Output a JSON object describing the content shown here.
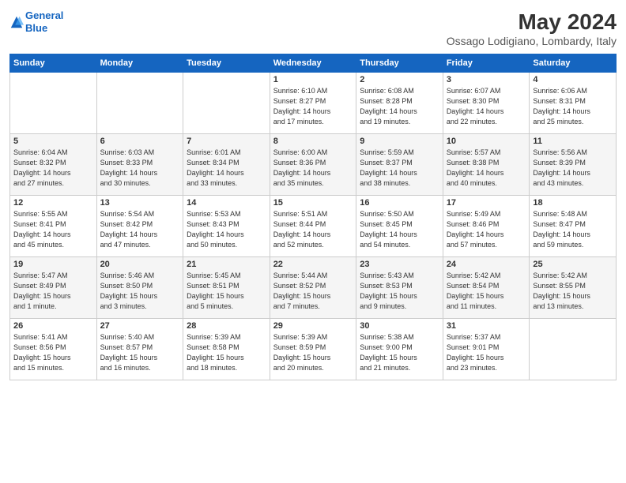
{
  "logo": {
    "line1": "General",
    "line2": "Blue"
  },
  "title": "May 2024",
  "subtitle": "Ossago Lodigiano, Lombardy, Italy",
  "days_header": [
    "Sunday",
    "Monday",
    "Tuesday",
    "Wednesday",
    "Thursday",
    "Friday",
    "Saturday"
  ],
  "weeks": [
    [
      {
        "day": "",
        "info": ""
      },
      {
        "day": "",
        "info": ""
      },
      {
        "day": "",
        "info": ""
      },
      {
        "day": "1",
        "info": "Sunrise: 6:10 AM\nSunset: 8:27 PM\nDaylight: 14 hours\nand 17 minutes."
      },
      {
        "day": "2",
        "info": "Sunrise: 6:08 AM\nSunset: 8:28 PM\nDaylight: 14 hours\nand 19 minutes."
      },
      {
        "day": "3",
        "info": "Sunrise: 6:07 AM\nSunset: 8:30 PM\nDaylight: 14 hours\nand 22 minutes."
      },
      {
        "day": "4",
        "info": "Sunrise: 6:06 AM\nSunset: 8:31 PM\nDaylight: 14 hours\nand 25 minutes."
      }
    ],
    [
      {
        "day": "5",
        "info": "Sunrise: 6:04 AM\nSunset: 8:32 PM\nDaylight: 14 hours\nand 27 minutes."
      },
      {
        "day": "6",
        "info": "Sunrise: 6:03 AM\nSunset: 8:33 PM\nDaylight: 14 hours\nand 30 minutes."
      },
      {
        "day": "7",
        "info": "Sunrise: 6:01 AM\nSunset: 8:34 PM\nDaylight: 14 hours\nand 33 minutes."
      },
      {
        "day": "8",
        "info": "Sunrise: 6:00 AM\nSunset: 8:36 PM\nDaylight: 14 hours\nand 35 minutes."
      },
      {
        "day": "9",
        "info": "Sunrise: 5:59 AM\nSunset: 8:37 PM\nDaylight: 14 hours\nand 38 minutes."
      },
      {
        "day": "10",
        "info": "Sunrise: 5:57 AM\nSunset: 8:38 PM\nDaylight: 14 hours\nand 40 minutes."
      },
      {
        "day": "11",
        "info": "Sunrise: 5:56 AM\nSunset: 8:39 PM\nDaylight: 14 hours\nand 43 minutes."
      }
    ],
    [
      {
        "day": "12",
        "info": "Sunrise: 5:55 AM\nSunset: 8:41 PM\nDaylight: 14 hours\nand 45 minutes."
      },
      {
        "day": "13",
        "info": "Sunrise: 5:54 AM\nSunset: 8:42 PM\nDaylight: 14 hours\nand 47 minutes."
      },
      {
        "day": "14",
        "info": "Sunrise: 5:53 AM\nSunset: 8:43 PM\nDaylight: 14 hours\nand 50 minutes."
      },
      {
        "day": "15",
        "info": "Sunrise: 5:51 AM\nSunset: 8:44 PM\nDaylight: 14 hours\nand 52 minutes."
      },
      {
        "day": "16",
        "info": "Sunrise: 5:50 AM\nSunset: 8:45 PM\nDaylight: 14 hours\nand 54 minutes."
      },
      {
        "day": "17",
        "info": "Sunrise: 5:49 AM\nSunset: 8:46 PM\nDaylight: 14 hours\nand 57 minutes."
      },
      {
        "day": "18",
        "info": "Sunrise: 5:48 AM\nSunset: 8:47 PM\nDaylight: 14 hours\nand 59 minutes."
      }
    ],
    [
      {
        "day": "19",
        "info": "Sunrise: 5:47 AM\nSunset: 8:49 PM\nDaylight: 15 hours\nand 1 minute."
      },
      {
        "day": "20",
        "info": "Sunrise: 5:46 AM\nSunset: 8:50 PM\nDaylight: 15 hours\nand 3 minutes."
      },
      {
        "day": "21",
        "info": "Sunrise: 5:45 AM\nSunset: 8:51 PM\nDaylight: 15 hours\nand 5 minutes."
      },
      {
        "day": "22",
        "info": "Sunrise: 5:44 AM\nSunset: 8:52 PM\nDaylight: 15 hours\nand 7 minutes."
      },
      {
        "day": "23",
        "info": "Sunrise: 5:43 AM\nSunset: 8:53 PM\nDaylight: 15 hours\nand 9 minutes."
      },
      {
        "day": "24",
        "info": "Sunrise: 5:42 AM\nSunset: 8:54 PM\nDaylight: 15 hours\nand 11 minutes."
      },
      {
        "day": "25",
        "info": "Sunrise: 5:42 AM\nSunset: 8:55 PM\nDaylight: 15 hours\nand 13 minutes."
      }
    ],
    [
      {
        "day": "26",
        "info": "Sunrise: 5:41 AM\nSunset: 8:56 PM\nDaylight: 15 hours\nand 15 minutes."
      },
      {
        "day": "27",
        "info": "Sunrise: 5:40 AM\nSunset: 8:57 PM\nDaylight: 15 hours\nand 16 minutes."
      },
      {
        "day": "28",
        "info": "Sunrise: 5:39 AM\nSunset: 8:58 PM\nDaylight: 15 hours\nand 18 minutes."
      },
      {
        "day": "29",
        "info": "Sunrise: 5:39 AM\nSunset: 8:59 PM\nDaylight: 15 hours\nand 20 minutes."
      },
      {
        "day": "30",
        "info": "Sunrise: 5:38 AM\nSunset: 9:00 PM\nDaylight: 15 hours\nand 21 minutes."
      },
      {
        "day": "31",
        "info": "Sunrise: 5:37 AM\nSunset: 9:01 PM\nDaylight: 15 hours\nand 23 minutes."
      },
      {
        "day": "",
        "info": ""
      }
    ]
  ]
}
